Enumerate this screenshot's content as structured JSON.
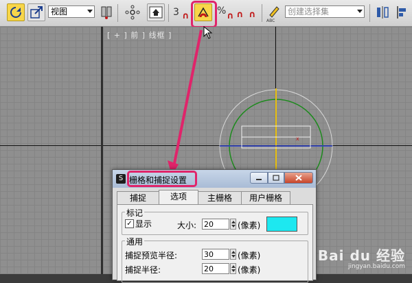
{
  "toolbar": {
    "view_select": "视图",
    "snap_number": "3",
    "percent_symbol": "%",
    "selection_set_placeholder": "创建选择集",
    "text_tool_label": "ABC"
  },
  "viewport": {
    "label": "[ + ] 前 ] 线框 ]"
  },
  "dialog": {
    "title": "栅格和捕捉设置",
    "title_icon": "S",
    "tabs": [
      {
        "label": "捕捉"
      },
      {
        "label": "选项"
      },
      {
        "label": "主栅格"
      },
      {
        "label": "用户栅格"
      }
    ],
    "marker_group": {
      "title": "标记",
      "display_label": "显示",
      "display_checked": true,
      "size_label": "大小:",
      "size_value": "20",
      "unit": "(像素)",
      "color": "#1de8f0"
    },
    "general_group": {
      "title": "通用",
      "preview_radius_label": "捕捉预览半径:",
      "preview_radius_value": "30",
      "snap_radius_label": "捕捉半径:",
      "snap_radius_value": "20",
      "unit": "(像素)"
    }
  },
  "watermark": {
    "main": "Bai du 经验",
    "sub": "jingyan.baidu.com"
  },
  "colors": {
    "highlight": "#e0246a",
    "viewport_bg": "#8f8f8f"
  }
}
